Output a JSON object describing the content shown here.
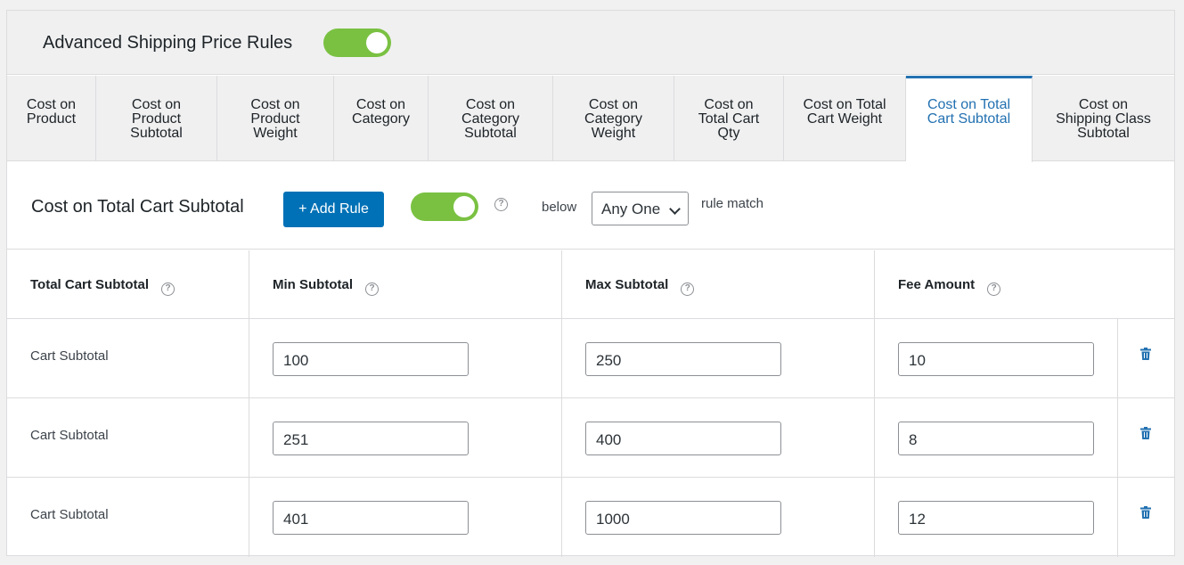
{
  "header": {
    "title": "Advanced Shipping Price Rules",
    "enabled": true
  },
  "tabs": [
    {
      "label": "Cost on\nProduct",
      "active": false
    },
    {
      "label": "Cost on\nProduct\nSubtotal",
      "active": false
    },
    {
      "label": "Cost on\nProduct\nWeight",
      "active": false
    },
    {
      "label": "Cost on\nCategory",
      "active": false
    },
    {
      "label": "Cost on\nCategory\nSubtotal",
      "active": false
    },
    {
      "label": "Cost on\nCategory\nWeight",
      "active": false
    },
    {
      "label": "Cost on\nTotal Cart\nQty",
      "active": false
    },
    {
      "label": "Cost on Total\nCart Weight",
      "active": false
    },
    {
      "label": "Cost on Total\nCart Subtotal",
      "active": true
    },
    {
      "label": "Cost on\nShipping Class\nSubtotal",
      "active": false
    }
  ],
  "rule": {
    "title": "Cost on Total Cart Subtotal",
    "add_label": "+ Add Rule",
    "enabled": true,
    "below_label": "below",
    "match_value": "Any One",
    "match_label": "rule match"
  },
  "table": {
    "headers": [
      "Total Cart Subtotal",
      "Min Subtotal",
      "Max Subtotal",
      "Fee Amount"
    ],
    "rows": [
      {
        "label": "Cart Subtotal",
        "min": "100",
        "max": "250",
        "fee": "10"
      },
      {
        "label": "Cart Subtotal",
        "min": "251",
        "max": "400",
        "fee": "8"
      },
      {
        "label": "Cart Subtotal",
        "min": "401",
        "max": "1000",
        "fee": "12"
      }
    ]
  },
  "icons": {
    "help": "question-circle-icon",
    "delete": "trash-icon"
  },
  "colors": {
    "accent": "#2271b1",
    "button": "#0071b6",
    "toggle_on": "#7ac142"
  }
}
